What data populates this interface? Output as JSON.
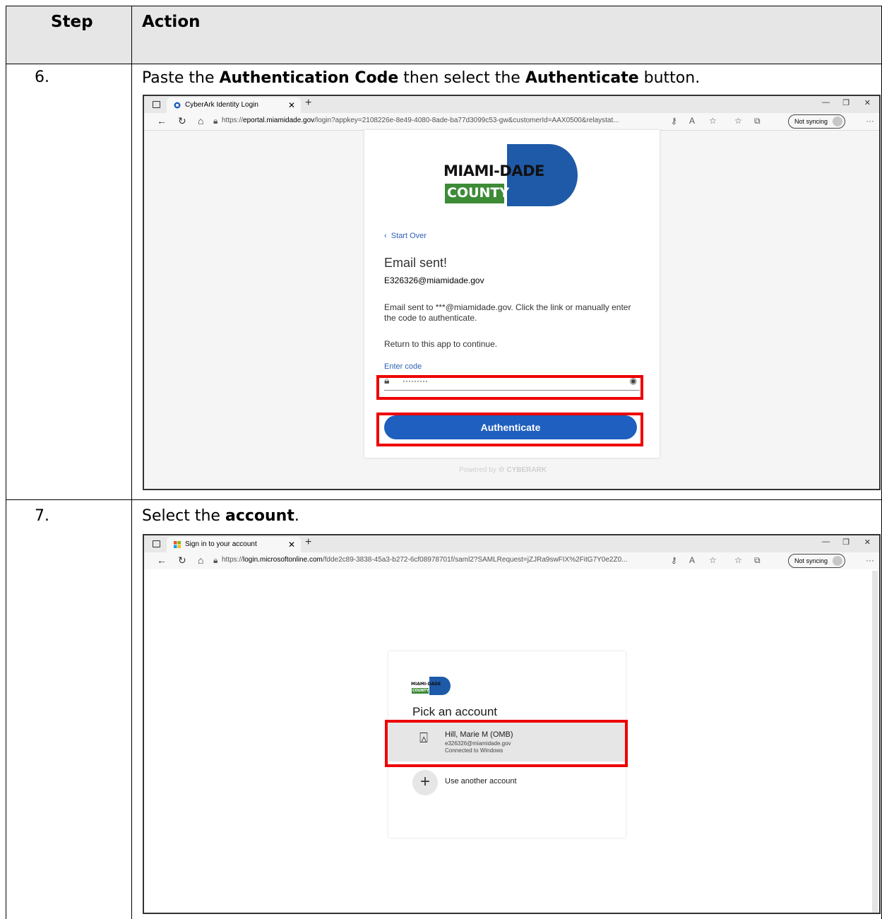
{
  "table": {
    "header": {
      "step": "Step",
      "action": "Action"
    },
    "rows": [
      {
        "step": "6.",
        "instruction": {
          "pre": "Paste the ",
          "b1": "Authentication Code",
          "mid": " then select the ",
          "b2": "Authenticate",
          "post": " button."
        },
        "browser": {
          "tab_title": "CyberArk Identity Login",
          "url_prefix": "https://",
          "url_domain": "eportal.miamidade.gov",
          "url_rest": "/login?appkey=2108226e-8e49-4080-8ade-ba77d3099c53-gw&customerId=AAX0500&relaystat...",
          "sync_label": "Not syncing"
        },
        "page": {
          "logo_top": "MIAMI-DADE",
          "logo_bottom": "COUNTY",
          "start_over": "Start Over",
          "heading": "Email sent!",
          "email": "E326326@miamidade.gov",
          "message": "Email sent to ***@miamidade.gov. Click the link or manually enter the code to authenticate.",
          "return_msg": "Return to this app to continue.",
          "code_label": "Enter code",
          "code_value": "·········",
          "button": "Authenticate",
          "powered": "Powered by",
          "brand": "CYBERARK"
        }
      },
      {
        "step": "7.",
        "instruction": {
          "pre": "Select the ",
          "b1": "account",
          "post": "."
        },
        "browser": {
          "tab_title": "Sign in to your account",
          "url_prefix": "https://",
          "url_domain": "login.microsoftonline.com",
          "url_rest": "/fdde2c89-3838-45a3-b272-6cf08978701f/saml2?SAMLRequest=jZJRa9swFIX%2FitG7Y0e2Z0...",
          "sync_label": "Not syncing"
        },
        "page": {
          "logo_top": "MIAMI-DADE",
          "logo_bottom": "COUNTY",
          "heading": "Pick an account",
          "account_name": "Hill, Marie M (OMB)",
          "account_email": "e326326@miamidade.gov",
          "account_status": "Connected to Windows",
          "other_account": "Use another account"
        }
      }
    ]
  },
  "colors": {
    "red_highlight": "#e00000",
    "button_blue": "#1f5fbf",
    "logo_blue": "#1e5aa8",
    "logo_green": "#3d8b37"
  }
}
